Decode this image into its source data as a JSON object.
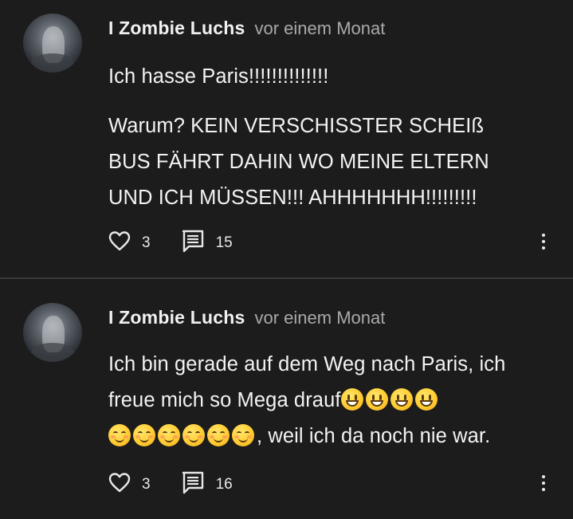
{
  "comments": [
    {
      "author": "I Zombie Luchs",
      "time": "vor einem Monat",
      "paragraphs": [
        "Ich hasse Paris!!!!!!!!!!!!!!",
        "Warum? KEIN VERSCHISSTER SCHEIß BUS FÄHRT DAHIN WO MEINE ELTERN UND ICH MÜSSEN!!! AHHHHHHH!!!!!!!!!"
      ],
      "likes": "3",
      "replies": "15"
    },
    {
      "author": "I Zombie Luchs",
      "time": "vor einem Monat",
      "text_start": "Ich bin gerade auf dem Weg nach Paris, ich freue mich so Mega drauf",
      "emojis_line1": [
        "grinning-face",
        "grinning-face",
        "grinning-face",
        "grinning-face"
      ],
      "emojis_line2": [
        "smiling-face-with-closed-eyes",
        "smiling-face-with-closed-eyes",
        "smiling-face-with-closed-eyes",
        "smiling-face-with-closed-eyes",
        "smiling-face-with-closed-eyes",
        "smiling-face-with-closed-eyes"
      ],
      "text_end": ", weil ich da noch nie war.",
      "likes": "3",
      "replies": "16"
    }
  ],
  "icons": {
    "like": "heart-outline-icon",
    "reply": "comment-lines-icon",
    "more": "vertical-ellipsis-icon"
  },
  "colors": {
    "background": "#1c1c1c",
    "divider": "#3a3a3a",
    "timestamp": "#a9a9a9",
    "text": "#f3f3f3"
  }
}
